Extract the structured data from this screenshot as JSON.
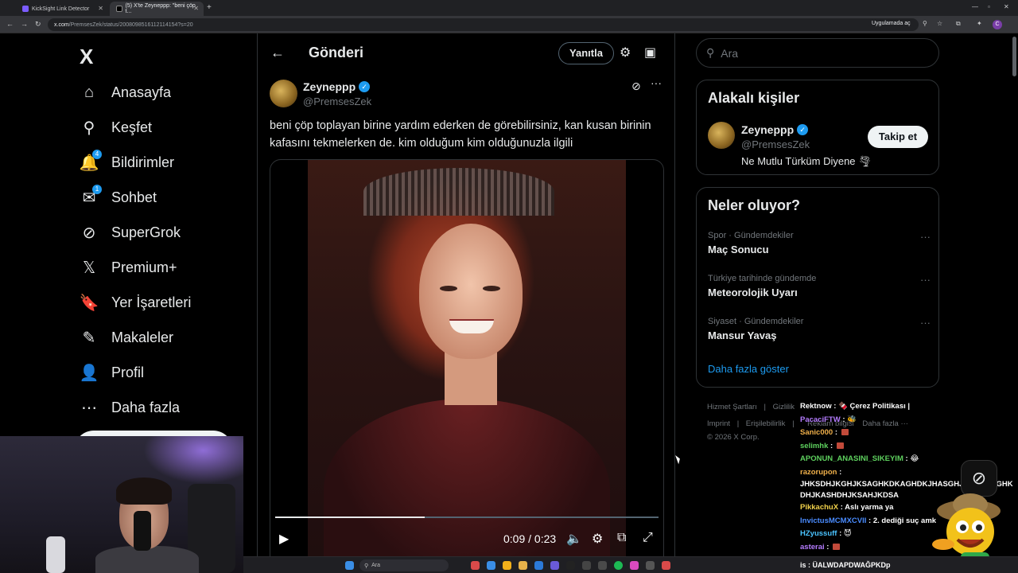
{
  "browser": {
    "tabs": [
      {
        "title": "KickSight Link Detector"
      },
      {
        "title": "(5) X'te Zeyneppp: \"beni çöp t..."
      }
    ],
    "new_tab": "+",
    "url_host": "x.com",
    "url_path": "/PremsesZek/status/2008098516112114154?s=20",
    "app_button": "Uygulamada aç",
    "profile_initial": "C"
  },
  "nav": {
    "logo": "X",
    "items": [
      {
        "label": "Anasayfa",
        "icon": "home-icon",
        "glyph": "⌂"
      },
      {
        "label": "Keşfet",
        "icon": "search-icon",
        "glyph": "⚲"
      },
      {
        "label": "Bildirimler",
        "icon": "bell-icon",
        "glyph": "🔔",
        "badge": "4"
      },
      {
        "label": "Sohbet",
        "icon": "mail-icon",
        "glyph": "✉",
        "badge": "1"
      },
      {
        "label": "SuperGrok",
        "icon": "grok-icon",
        "glyph": "⊘"
      },
      {
        "label": "Premium+",
        "icon": "x-premium-icon",
        "glyph": "𝕏"
      },
      {
        "label": "Yer İşaretleri",
        "icon": "bookmark-icon",
        "glyph": "🔖"
      },
      {
        "label": "Makaleler",
        "icon": "article-icon",
        "glyph": "✎"
      },
      {
        "label": "Profil",
        "icon": "person-icon",
        "glyph": "👤"
      },
      {
        "label": "Daha fazla",
        "icon": "more-circle-icon",
        "glyph": "⋯"
      }
    ]
  },
  "post": {
    "header_title": "Gönderi",
    "reply_label": "Yanıtla",
    "author_name": "Zeyneppp",
    "author_handle": "@PremsesZek",
    "text": "beni çöp toplayan birine yardım ederken de görebilirsiniz, kan kusan birinin kafasını tekmelerken de. kim olduğum kim olduğunuzla ilgili",
    "video": {
      "current": "0:09",
      "duration": "0:23",
      "time_label": "0:09 / 0:23",
      "progress": 0.39
    }
  },
  "sidebar": {
    "search_placeholder": "Ara",
    "related_title": "Alakalı kişiler",
    "related": {
      "name": "Zeyneppp",
      "handle": "@PremsesZek",
      "bio": "Ne Mutlu Türküm Diyene 🌪",
      "follow_label": "Takip et"
    },
    "trends_title": "Neler oluyor?",
    "trends": [
      {
        "context": "Spor · Gündemdekiler",
        "name": "Maç Sonucu"
      },
      {
        "context": "Türkiye tarihinde gündemde",
        "name": "Meteorolojik Uyarı"
      },
      {
        "context": "Siyaset · Gündemdekiler",
        "name": "Mansur Yavaş"
      }
    ],
    "show_more": "Daha fazla göster",
    "footer": {
      "line1": [
        "Hizmet Şartları",
        "|",
        "Gizlilik"
      ],
      "line2": [
        "Imprint",
        "|",
        "Erişilebilirlik",
        "|"
      ],
      "copyright": "© 2026 X Corp."
    }
  },
  "chat": [
    {
      "user": "Rektnow",
      "color": "#ffffff",
      "text": "🍫 Çerez Politikası |"
    },
    {
      "user": "PacaciFTW",
      "color": "#b57cff",
      "text": "🐝"
    },
    {
      "user": "Sanic000",
      "color": "#f0b04a",
      "text": ""
    },
    {
      "user": "selimhk",
      "color": "#5ed15e",
      "text": ""
    },
    {
      "user": "APONUN_ANASINI_SIKEYIM",
      "color": "#5ed15e",
      "text": "😂"
    },
    {
      "user": "razorupon",
      "color": "#f0b04a",
      "text": ""
    },
    {
      "user": "",
      "color": "#ffffff",
      "text": "JHKSDHJKGHJKSAGHKDKAGHDKJHASGHJKDGHSAGHKDHJKASHDHJKSAHJKDSA"
    },
    {
      "user": "PikkachuX",
      "color": "#f0d04a",
      "text": "Aslı yarma ya"
    },
    {
      "user": "InvictusMCMXCVII",
      "color": "#4a8cff",
      "text": "2. dediği suç amk"
    },
    {
      "user": "HZyussuff",
      "color": "#4ac3ff",
      "text": "😈"
    },
    {
      "user": "asterai",
      "color": "#b57cff",
      "text": ""
    }
  ],
  "footer_overlay": {
    "rekl": "Reklam bilgisi",
    "daha": "Daha fazla ···"
  },
  "taskbar": {
    "search_label": "Ara",
    "ticker": "is : ÜALWDAPDWAĞPKDp"
  }
}
